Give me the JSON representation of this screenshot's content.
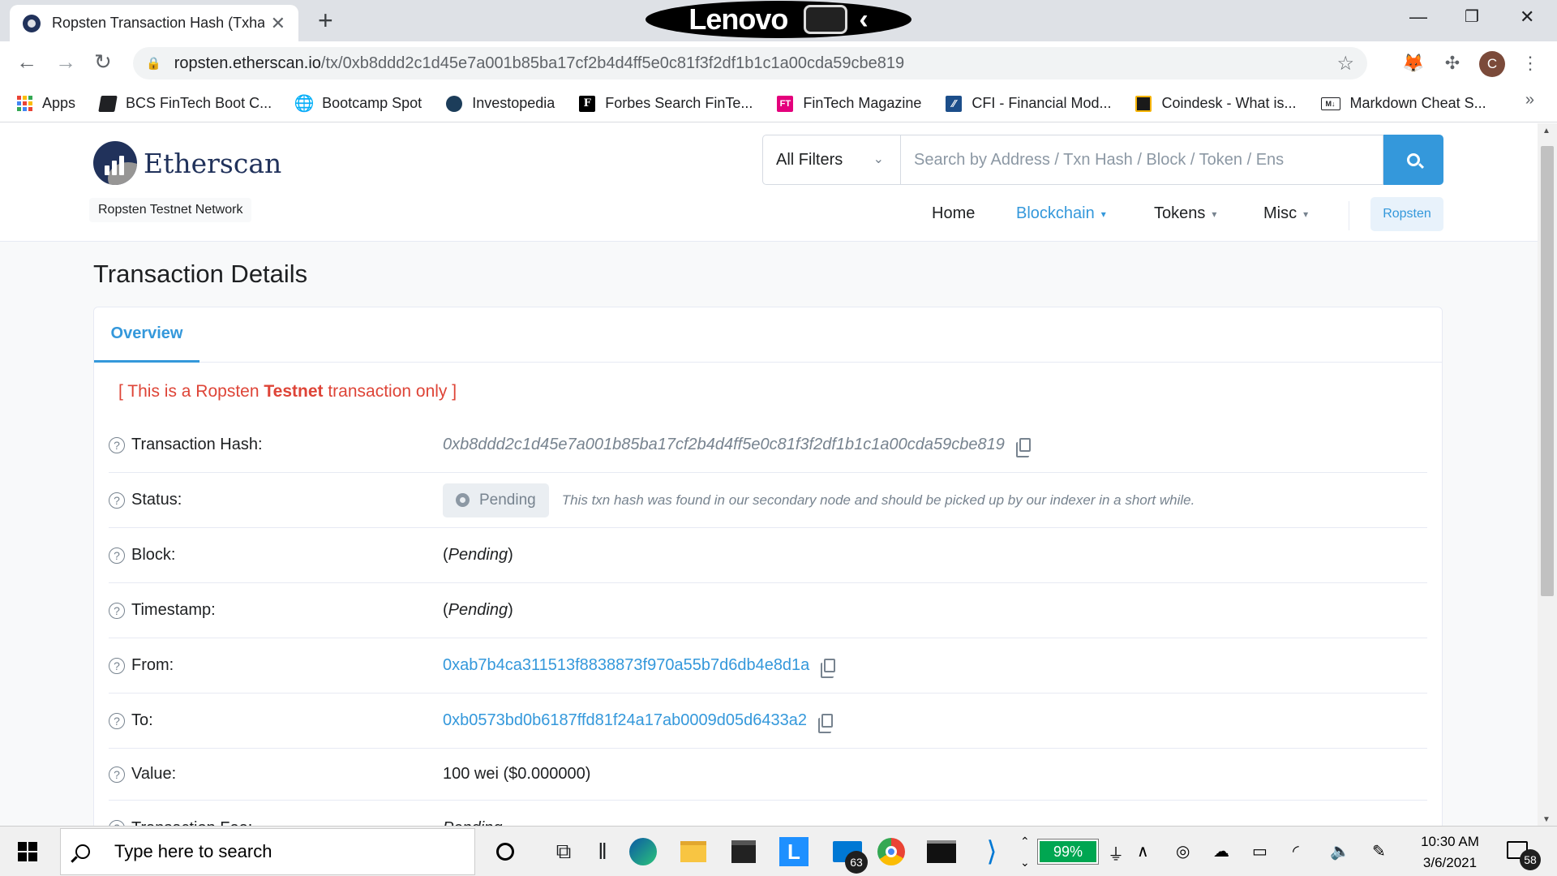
{
  "browser": {
    "tab_title": "Ropsten Transaction Hash (Txhash)",
    "url_host": "ropsten.etherscan.io",
    "url_path": "/tx/0xb8ddd2c1d45e7a001b85ba17cf2b4d4ff5e0c81f3f2df1b1c1a00cda59cbe819",
    "profile_initial": "C",
    "lenovo_label": "Lenovo"
  },
  "bookmarks": [
    {
      "label": "Apps",
      "icon": "apps-grid-icon"
    },
    {
      "label": "BCS FinTech Boot C...",
      "icon": "bookmark-bcs-icon"
    },
    {
      "label": "Bootcamp Spot",
      "icon": "globe-icon"
    },
    {
      "label": "Investopedia",
      "icon": "investopedia-icon"
    },
    {
      "label": "Forbes Search FinTe...",
      "icon": "forbes-icon"
    },
    {
      "label": "FinTech Magazine",
      "icon": "fintech-magazine-icon"
    },
    {
      "label": "CFI - Financial Mod...",
      "icon": "cfi-icon"
    },
    {
      "label": "Coindesk - What is...",
      "icon": "coindesk-icon"
    },
    {
      "label": "Markdown Cheat S...",
      "icon": "markdown-icon"
    }
  ],
  "site": {
    "logo_text": "Etherscan",
    "network_label": "Ropsten Testnet Network",
    "filter_label": "All Filters",
    "search_placeholder": "Search by Address / Txn Hash / Block / Token / Ens",
    "nav": {
      "home": "Home",
      "blockchain": "Blockchain",
      "tokens": "Tokens",
      "misc": "Misc",
      "network_btn": "Ropsten"
    },
    "accent_color": "#3498db"
  },
  "tx": {
    "page_title": "Transaction Details",
    "tab_overview": "Overview",
    "notice_prefix": "[ This is a Ropsten ",
    "notice_bold": "Testnet",
    "notice_suffix": " transaction only ]",
    "rows": {
      "hash_label": "Transaction Hash:",
      "hash_value": "0xb8ddd2c1d45e7a001b85ba17cf2b4d4ff5e0c81f3f2df1b1c1a00cda59cbe819",
      "status_label": "Status:",
      "status_value": "Pending",
      "status_note": "This txn hash was found in our secondary node and should be picked up by our indexer in a short while.",
      "block_label": "Block:",
      "block_value": "Pending",
      "timestamp_label": "Timestamp:",
      "timestamp_value": "Pending",
      "from_label": "From:",
      "from_value": "0xab7b4ca311513f8838873f970a55b7d6db4e8d1a",
      "to_label": "To:",
      "to_value": "0xb0573bd0b6187ffd81f24a17ab0009d05d6433a2",
      "value_label": "Value:",
      "value_value": "100 wei ($0.000000)",
      "fee_label": "Transaction Fee:",
      "fee_value": "Pending"
    }
  },
  "taskbar": {
    "search_placeholder": "Type here to search",
    "mail_badge": "63",
    "battery": "99%",
    "time": "10:30 AM",
    "date": "3/6/2021",
    "notif_count": "58"
  }
}
